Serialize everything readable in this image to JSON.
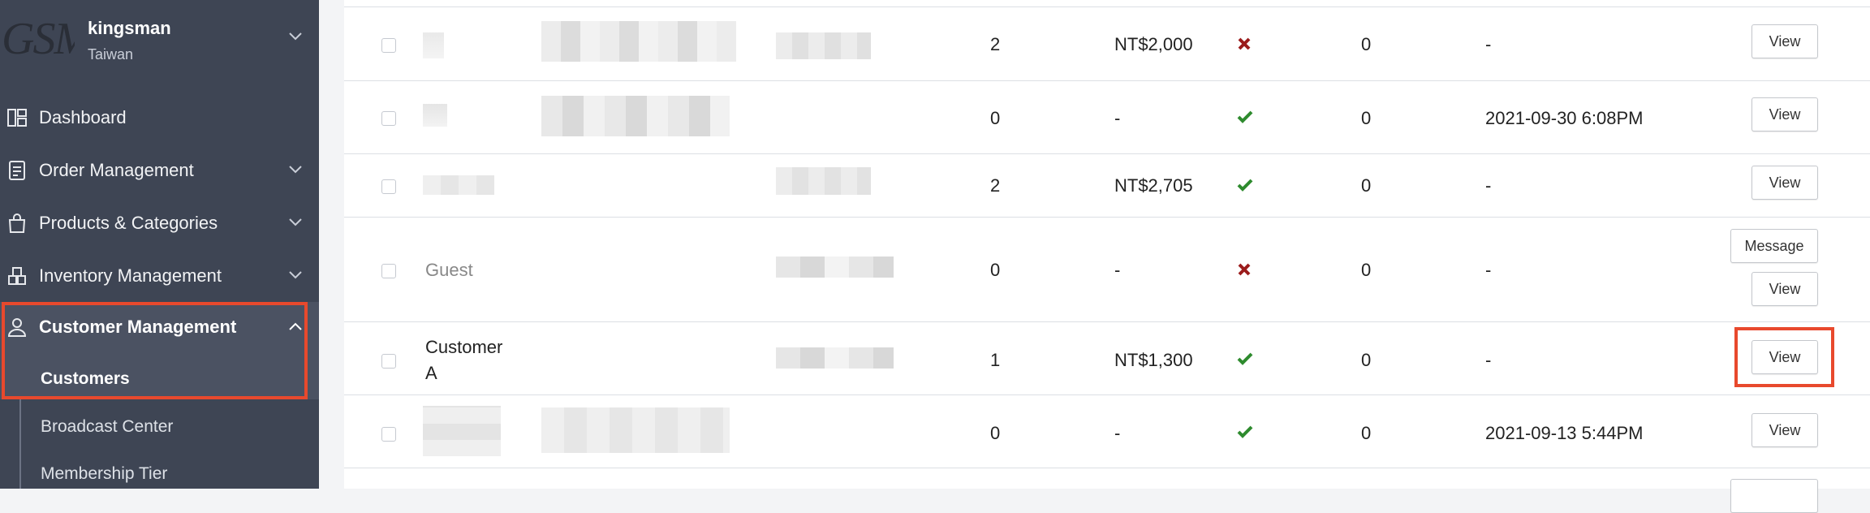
{
  "store": {
    "logo_text": "GSM",
    "name": "kingsman",
    "region": "Taiwan"
  },
  "nav": {
    "items": [
      {
        "label": "Dashboard",
        "icon": "dashboard-icon"
      },
      {
        "label": "Order Management",
        "icon": "receipt-icon"
      },
      {
        "label": "Products & Categories",
        "icon": "shopping-bag-icon"
      },
      {
        "label": "Inventory Management",
        "icon": "boxes-icon"
      },
      {
        "label": "Customer Management",
        "icon": "person-icon"
      }
    ],
    "subitems": [
      {
        "label": "Customers",
        "selected": true
      },
      {
        "label": "Broadcast Center",
        "selected": false
      },
      {
        "label": "Membership Tier",
        "selected": false
      }
    ]
  },
  "table": {
    "rows": [
      {
        "name": "",
        "orders": "2",
        "total": "NT$2,000",
        "status": "cross",
        "points": "0",
        "date": "-",
        "buttons": [
          "View"
        ]
      },
      {
        "name": "",
        "orders": "0",
        "total": "-",
        "status": "check",
        "points": "0",
        "date": "2021-09-30 6:08PM",
        "buttons": [
          "View"
        ]
      },
      {
        "name": "",
        "orders": "2",
        "total": "NT$2,705",
        "status": "check",
        "points": "0",
        "date": "-",
        "buttons": [
          "View"
        ]
      },
      {
        "name": "Guest",
        "orders": "0",
        "total": "-",
        "status": "cross",
        "points": "0",
        "date": "-",
        "buttons": [
          "Message",
          "View"
        ]
      },
      {
        "name_line1": "Customer",
        "name_line2": "A",
        "orders": "1",
        "total": "NT$1,300",
        "status": "check",
        "points": "0",
        "date": "-",
        "buttons": [
          "View"
        ]
      },
      {
        "name": "",
        "orders": "0",
        "total": "-",
        "status": "check",
        "points": "0",
        "date": "2021-09-13 5:44PM",
        "buttons": [
          "View"
        ]
      }
    ]
  },
  "colors": {
    "sidebar_bg": "#3e4554",
    "highlight": "#e8492d",
    "check": "#2e8b2e",
    "cross": "#9b1c1c"
  }
}
